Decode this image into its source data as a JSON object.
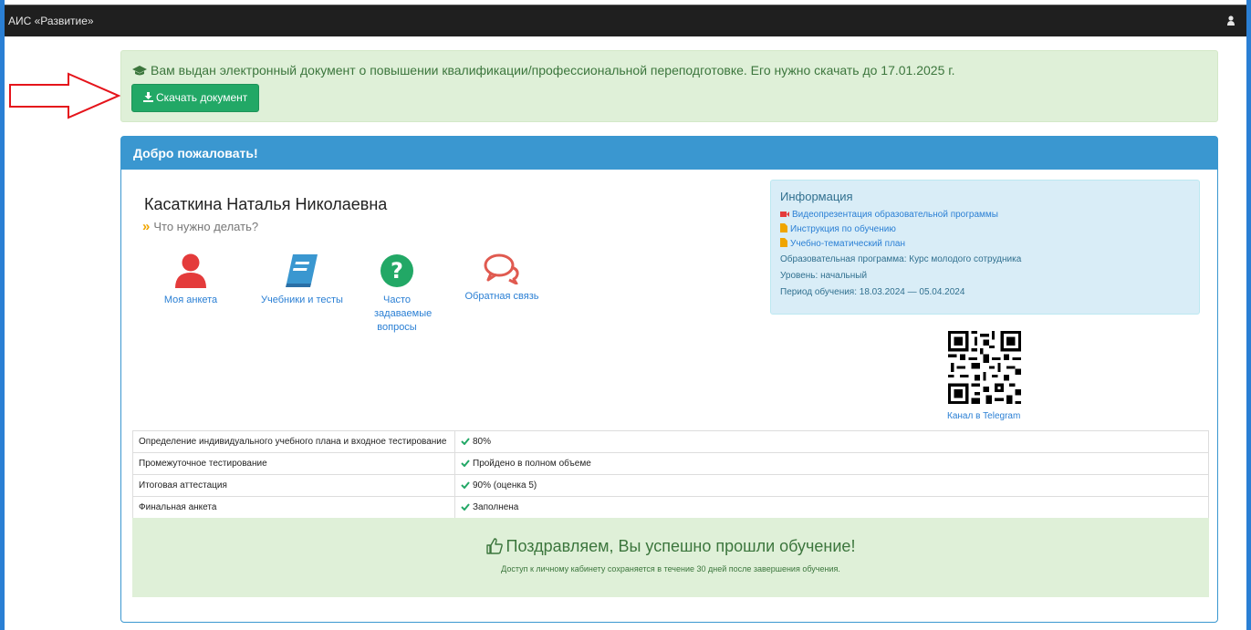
{
  "app": {
    "brand": "АИС «Развитие»",
    "user_icon": "user-icon"
  },
  "alert": {
    "text": "Вам выдан электронный документ о повышении квалификации/профессиональной переподготовке. Его нужно скачать до 17.01.2025 г.",
    "icon": "graduation-cap-icon",
    "button_label": "Скачать документ",
    "button_icon": "download-icon"
  },
  "panel": {
    "title": "Добро пожаловать!",
    "full_name": "Касаткина Наталья Николаевна",
    "todo_marker": "»",
    "todo_label": "Что нужно делать?"
  },
  "tiles": [
    {
      "label": "Моя анкета",
      "icon": "user-icon",
      "color": "#e43b3b"
    },
    {
      "label": "Учебники и тесты",
      "icon": "book-icon",
      "color": "#3a97d0"
    },
    {
      "label": "Часто задаваемые вопросы",
      "icon": "question-icon",
      "color": "#22a866"
    },
    {
      "label": "Обратная связь",
      "icon": "comments-icon",
      "color": "#e05a50"
    }
  ],
  "info": {
    "title": "Информация",
    "links": [
      {
        "label": "Видеопрезентация образовательной программы",
        "icon": "video-camera-icon",
        "color": "#e43b3b"
      },
      {
        "label": "Инструкция по обучению",
        "icon": "file-icon",
        "color": "#f0a500"
      },
      {
        "label": "Учебно-тематический план",
        "icon": "file-icon",
        "color": "#f0a500"
      }
    ],
    "program": "Образовательная программа: Курс молодого сотрудника",
    "level": "Уровень: начальный",
    "period": "Период обучения: 18.03.2024 — 05.04.2024"
  },
  "telegram": {
    "label": "Канал в Telegram"
  },
  "progress": [
    {
      "step": "Определение индивидуального учебного плана и входное тестирование",
      "result": "80%"
    },
    {
      "step": "Промежуточное тестирование",
      "result": "Пройдено в полном объеме"
    },
    {
      "step": "Итоговая аттестация",
      "result": "90% (оценка 5)"
    },
    {
      "step": "Финальная анкета",
      "result": "Заполнена"
    }
  ],
  "congrats": {
    "title": "Поздравляем, Вы успешно прошли обучение!",
    "subtitle": "Доступ к личному кабинету сохраняется в течение 30 дней после завершения обучения."
  },
  "colors": {
    "accent": "#3a97d0",
    "success": "#22a866",
    "alert_bg": "#dff0d8",
    "topbar": "#1f1f1f"
  }
}
